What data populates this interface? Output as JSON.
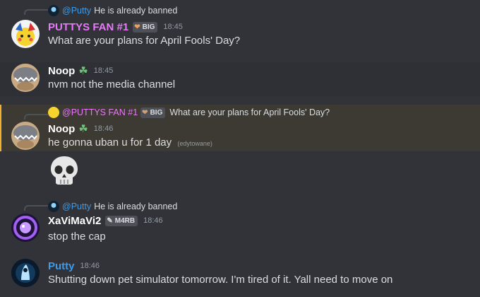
{
  "messages": [
    {
      "reply": {
        "name": "@Putty",
        "text": "He is already banned"
      },
      "author": "PUTTYS FAN #1",
      "badge": "BIG",
      "time": "18:45",
      "text": "What are your plans for April Fools' Day?",
      "colors": {
        "author": "#e879f9"
      }
    },
    {
      "author": "Noop",
      "time": "18:45",
      "text": "nvm not the media channel",
      "colors": {
        "author": "#ffffff"
      }
    },
    {
      "reply": {
        "name": "@PUTTYS FAN #1",
        "badge": "BIG",
        "text": "What are your plans for April Fools' Day?"
      },
      "author": "Noop",
      "time": "18:46",
      "text": "he gonna uban u for 1 day",
      "edited": "(edytowane)",
      "emoji": "skull-emoji",
      "colors": {
        "author": "#ffffff",
        "reply_name": "#e879f9"
      }
    },
    {
      "reply": {
        "name": "@Putty",
        "text": "He is already banned"
      },
      "author": "XaViMaVi2",
      "badge": "M4RB",
      "time": "18:46",
      "text": "stop the cap",
      "colors": {
        "author": "#ffffff"
      }
    },
    {
      "author": "Putty",
      "time": "18:46",
      "text": "Shutting down pet simulator tomorrow. I'm tired of it. Yall need to move on",
      "colors": {
        "author": "#3f9be8"
      }
    }
  ]
}
